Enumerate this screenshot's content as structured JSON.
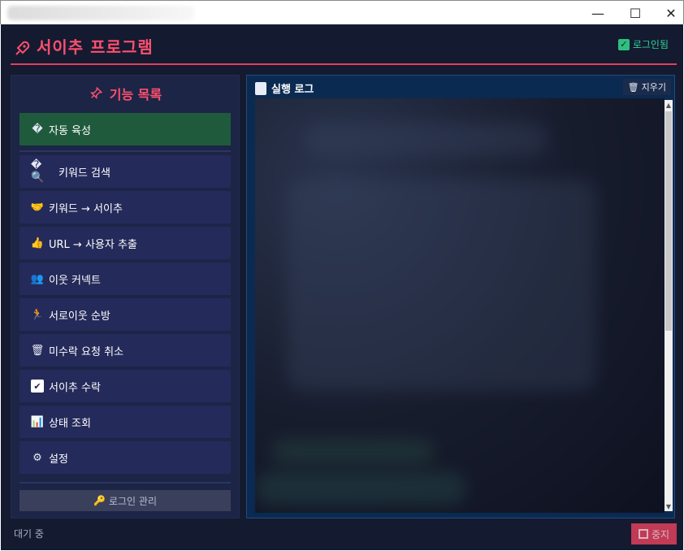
{
  "window": {
    "minimize_glyph": "—",
    "maximize_glyph": "☐",
    "close_glyph": "✕"
  },
  "header": {
    "title": "서이추 프로그램",
    "login_status": "로그인됨",
    "accent_color": "#ff4f6e"
  },
  "sidebar": {
    "title": "기능 목록",
    "items": [
      {
        "label": "자동 육성",
        "icon": "leaf-icon",
        "glyph": "�"
      },
      {
        "label": "키워드 검색",
        "icon": "search-icon",
        "glyph": "�🔍"
      },
      {
        "label": "키워드 → 서이추",
        "icon": "handshake-icon",
        "glyph": "🤝"
      },
      {
        "label": "URL → 사용자 추출",
        "icon": "thumbs-up-icon",
        "glyph": "👍"
      },
      {
        "label": "이웃 커넥트",
        "icon": "users-icon",
        "glyph": "👥"
      },
      {
        "label": "서로이웃 순방",
        "icon": "runner-icon",
        "glyph": "🏃"
      },
      {
        "label": "미수락 요청 취소",
        "icon": "trash-icon",
        "glyph": "🗑"
      },
      {
        "label": "서이추 수락",
        "icon": "checkbox-icon",
        "glyph": "✔"
      },
      {
        "label": "상태 조회",
        "icon": "bar-chart-icon",
        "glyph": "📊"
      },
      {
        "label": "설정",
        "icon": "gear-icon",
        "glyph": "⚙"
      }
    ],
    "login_manage": "로그인 관리"
  },
  "log": {
    "title": "실행 로그",
    "clear_label": "지우기"
  },
  "status": {
    "text": "대기 중",
    "stop_label": "중지"
  }
}
